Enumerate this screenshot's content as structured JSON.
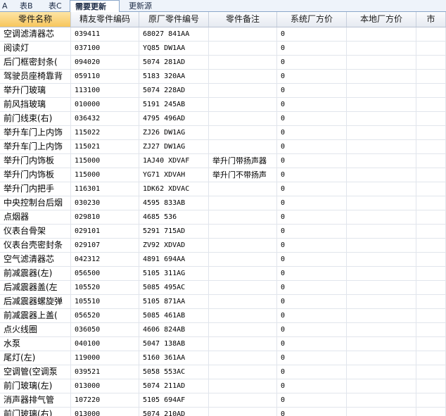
{
  "tabs": [
    {
      "label": "A"
    },
    {
      "label": "表B"
    },
    {
      "label": "表C"
    },
    {
      "label": "需要更新"
    },
    {
      "label": "更新源"
    }
  ],
  "columns": [
    "零件名称",
    "精友零件编码",
    "原厂零件编号",
    "零件备注",
    "系统厂方价",
    "本地厂方价",
    "市"
  ],
  "rows": [
    {
      "name": "空调滤清器芯",
      "code": "039411",
      "oem": "68027 841AA",
      "note": "",
      "sys_price": "0",
      "local_price": "",
      "market": ""
    },
    {
      "name": "阅读灯",
      "code": "037100",
      "oem": "YQ85 DW1AA",
      "note": "",
      "sys_price": "0",
      "local_price": "",
      "market": ""
    },
    {
      "name": "后门框密封条(",
      "code": "094020",
      "oem": "5074 281AD",
      "note": "",
      "sys_price": "0",
      "local_price": "",
      "market": ""
    },
    {
      "name": "驾驶员座椅靠背",
      "code": "059110",
      "oem": "5183 320AA",
      "note": "",
      "sys_price": "0",
      "local_price": "",
      "market": ""
    },
    {
      "name": "举升门玻璃",
      "code": "113100",
      "oem": "5074 228AD",
      "note": "",
      "sys_price": "0",
      "local_price": "",
      "market": ""
    },
    {
      "name": "前风挡玻璃",
      "code": "010000",
      "oem": "5191 245AB",
      "note": "",
      "sys_price": "0",
      "local_price": "",
      "market": ""
    },
    {
      "name": "前门线束(右)",
      "code": "036432",
      "oem": "4795 496AD",
      "note": "",
      "sys_price": "0",
      "local_price": "",
      "market": ""
    },
    {
      "name": "举升车门上内饰",
      "code": "115022",
      "oem": "ZJ26 DW1AG",
      "note": "",
      "sys_price": "0",
      "local_price": "",
      "market": ""
    },
    {
      "name": "举升车门上内饰",
      "code": "115021",
      "oem": "ZJ27 DW1AG",
      "note": "",
      "sys_price": "0",
      "local_price": "",
      "market": ""
    },
    {
      "name": "举升门内饰板",
      "code": "115000",
      "oem": "1AJ40 XDVAF",
      "note": "举升门带扬声器",
      "sys_price": "0",
      "local_price": "",
      "market": ""
    },
    {
      "name": "举升门内饰板",
      "code": "115000",
      "oem": "YG71 XDVAH",
      "note": "举升门不带扬声",
      "sys_price": "0",
      "local_price": "",
      "market": ""
    },
    {
      "name": "举升门内把手",
      "code": "116301",
      "oem": "1DK62 XDVAC",
      "note": "",
      "sys_price": "0",
      "local_price": "",
      "market": ""
    },
    {
      "name": "中央控制台后烟",
      "code": "030230",
      "oem": "4595 833AB",
      "note": "",
      "sys_price": "0",
      "local_price": "",
      "market": ""
    },
    {
      "name": "点烟器",
      "code": "029810",
      "oem": "4685 536",
      "note": "",
      "sys_price": "0",
      "local_price": "",
      "market": ""
    },
    {
      "name": "仪表台骨架",
      "code": "029101",
      "oem": "5291 715AD",
      "note": "",
      "sys_price": "0",
      "local_price": "",
      "market": ""
    },
    {
      "name": "仪表台壳密封条",
      "code": "029107",
      "oem": "ZV92 XDVAD",
      "note": "",
      "sys_price": "0",
      "local_price": "",
      "market": ""
    },
    {
      "name": "空气滤清器芯",
      "code": "042312",
      "oem": "4891 694AA",
      "note": "",
      "sys_price": "0",
      "local_price": "",
      "market": ""
    },
    {
      "name": "前减震器(左)",
      "code": "056500",
      "oem": "5105 311AG",
      "note": "",
      "sys_price": "0",
      "local_price": "",
      "market": ""
    },
    {
      "name": "后减震器盖(左",
      "code": "105520",
      "oem": "5085 495AC",
      "note": "",
      "sys_price": "0",
      "local_price": "",
      "market": ""
    },
    {
      "name": "后减震器螺旋弹",
      "code": "105510",
      "oem": "5105 871AA",
      "note": "",
      "sys_price": "0",
      "local_price": "",
      "market": ""
    },
    {
      "name": "前减震器上盖(",
      "code": "056520",
      "oem": "5085 461AB",
      "note": "",
      "sys_price": "0",
      "local_price": "",
      "market": ""
    },
    {
      "name": "点火线圈",
      "code": "036050",
      "oem": "4606 824AB",
      "note": "",
      "sys_price": "0",
      "local_price": "",
      "market": ""
    },
    {
      "name": "水泵",
      "code": "040100",
      "oem": "5047 138AB",
      "note": "",
      "sys_price": "0",
      "local_price": "",
      "market": ""
    },
    {
      "name": "尾灯(左)",
      "code": "119000",
      "oem": "5160 361AA",
      "note": "",
      "sys_price": "0",
      "local_price": "",
      "market": ""
    },
    {
      "name": "空调管(空调泵",
      "code": "039521",
      "oem": "5058 553AC",
      "note": "",
      "sys_price": "0",
      "local_price": "",
      "market": ""
    },
    {
      "name": "前门玻璃(左)",
      "code": "013000",
      "oem": "5074 211AD",
      "note": "",
      "sys_price": "0",
      "local_price": "",
      "market": ""
    },
    {
      "name": "消声器排气管",
      "code": "107220",
      "oem": "5105 694AF",
      "note": "",
      "sys_price": "0",
      "local_price": "",
      "market": ""
    },
    {
      "name": "前门玻璃(右)",
      "code": "013000",
      "oem": "5074 210AD",
      "note": "",
      "sys_price": "0",
      "local_price": "",
      "market": ""
    }
  ]
}
